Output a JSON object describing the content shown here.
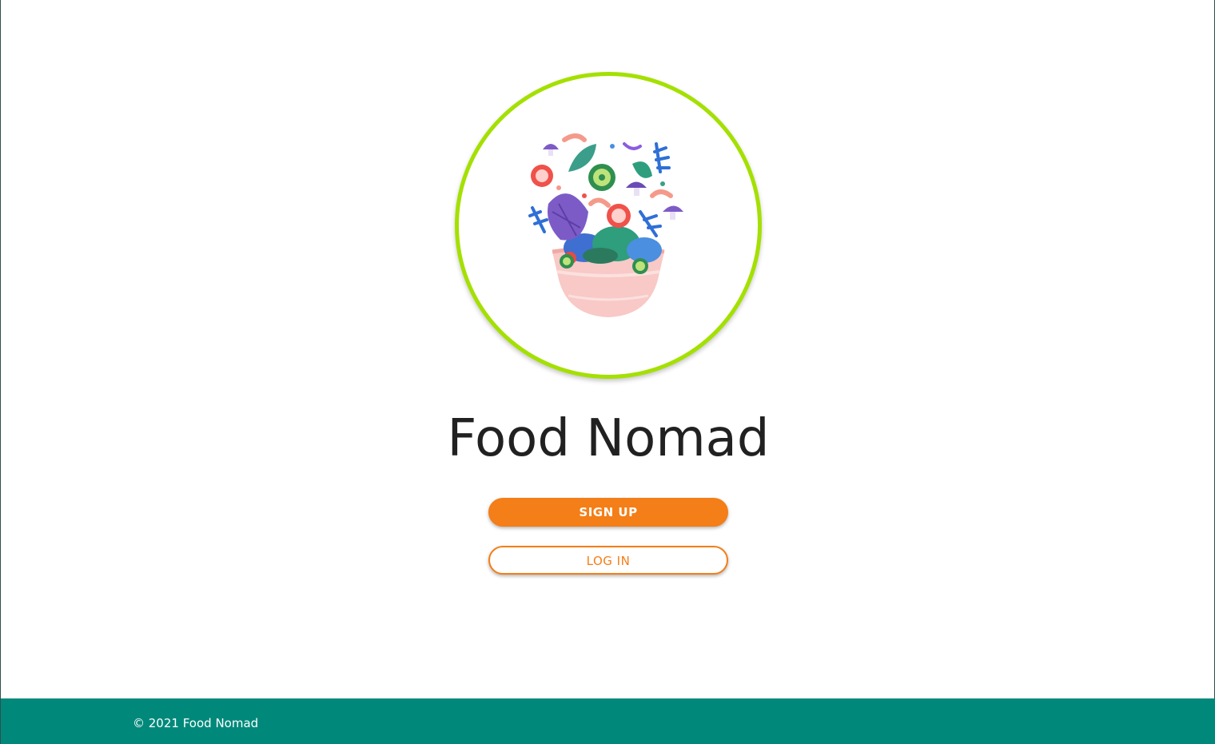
{
  "app": {
    "title": "Food Nomad"
  },
  "logo": {
    "icon": "salad-bowl-icon",
    "ring_color": "#a4e000"
  },
  "actions": {
    "signup_label": "SIGN UP",
    "login_label": "LOG IN",
    "accent_color": "#f47e17"
  },
  "footer": {
    "copyright": "© 2021 Food Nomad",
    "background_color": "#00897b"
  }
}
